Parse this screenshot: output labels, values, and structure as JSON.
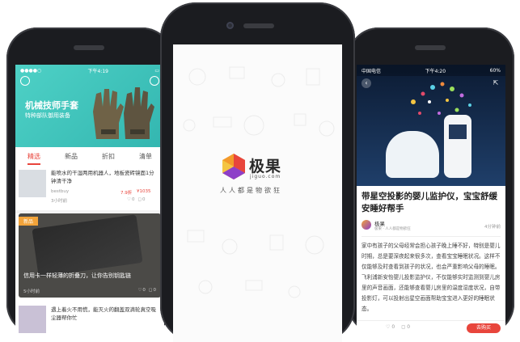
{
  "left_phone": {
    "status_time": "下午4:19",
    "banner": {
      "title": "机械技师手套",
      "subtitle": "特种部队御用装备"
    },
    "tabs": [
      {
        "label": "精选",
        "active": true
      },
      {
        "label": "新品",
        "active": false
      },
      {
        "label": "折扣",
        "active": false
      },
      {
        "label": "清单",
        "active": false
      }
    ],
    "item1": {
      "title": "能喷水的干湿两用机器人，地板瓷砖镜面1分钟清干净",
      "source": "bestbuy",
      "time": "3小时前",
      "price_orig": "7.9折",
      "price": "¥1035",
      "likes": "0",
      "comments": "0"
    },
    "item2": {
      "badge": "新品",
      "title": "信用卡一样轻薄的折叠刀，让你告别钥匙链",
      "time": "5小时前",
      "likes": "0",
      "comments": "0"
    },
    "item3": {
      "title": "遇上着火不用慌，能灭火的翻盖双滴轮真空吸尘器帮你忙"
    }
  },
  "center_phone": {
    "brand_cn": "极果",
    "brand_en": "jiguo.com",
    "slogan": "人人都是物欲狂"
  },
  "right_phone": {
    "status_carrier": "中国电信",
    "status_time": "下午4:20",
    "status_battery": "60%",
    "title": "带星空投影的婴儿监护仪，宝宝舒缓安睡好帮手",
    "author": "极果",
    "author_sub": "极果 · 人人都是物欲狂",
    "time": "4分钟前",
    "body": "家中有孩子的父母经常会担心孩子晚上睡不好，特别是婴儿时期，总是要深夜起来很多次，查看宝宝睡眠状况。这样不仅能够及时查看到孩子的状况，也会严重影响父母的睡眠。飞利浦新安怡婴儿投影监护仪，不仅能够实时监测到婴儿房里的声音画面，还能够查看婴儿房里的温度湿度状况，自带投影灯，可以投射出星空画面帮助宝宝进入更好的睡眠状态。",
    "likes": "0",
    "comments": "0",
    "buy_label": "去购买"
  },
  "colors": {
    "accent": "#e8453c",
    "phone": "#1b1c20",
    "teal": "#3fc1b8"
  }
}
